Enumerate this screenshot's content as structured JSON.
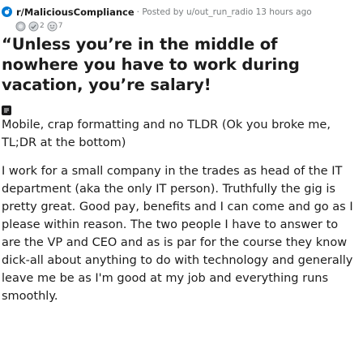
{
  "header": {
    "subreddit": "r/MaliciousCompliance",
    "posted_by": "· Posted by u/out_run_radio 13 hours ago"
  },
  "awards": [
    {
      "icon": "award-silver-icon",
      "count": ""
    },
    {
      "icon": "award-helpful-icon",
      "count": "2"
    },
    {
      "icon": "award-wholesome-icon",
      "count": "7"
    }
  ],
  "post": {
    "title": "“Unless you’re in the middle of nowhere you have to work during vacation, you’re salary!",
    "flair_icon": "text-post-icon",
    "paragraphs": [
      "Mobile, crap formatting and no TLDR (Ok you broke me, TL;DR at the bottom)",
      "I work for a small company in the trades as head of the IT department (aka the only IT person). Truthfully the gig is pretty great. Good pay, benefits and I can come and go as I please within reason. The two people I have to answer to are the VP and CEO and as is par for the course they know dick-all about anything to do with technology and generally leave me be as I'm good at my job and everything runs smoothly."
    ]
  },
  "colors": {
    "accent": "#0079d3",
    "meta_text": "#787c7e",
    "text": "#1c1c1c"
  }
}
